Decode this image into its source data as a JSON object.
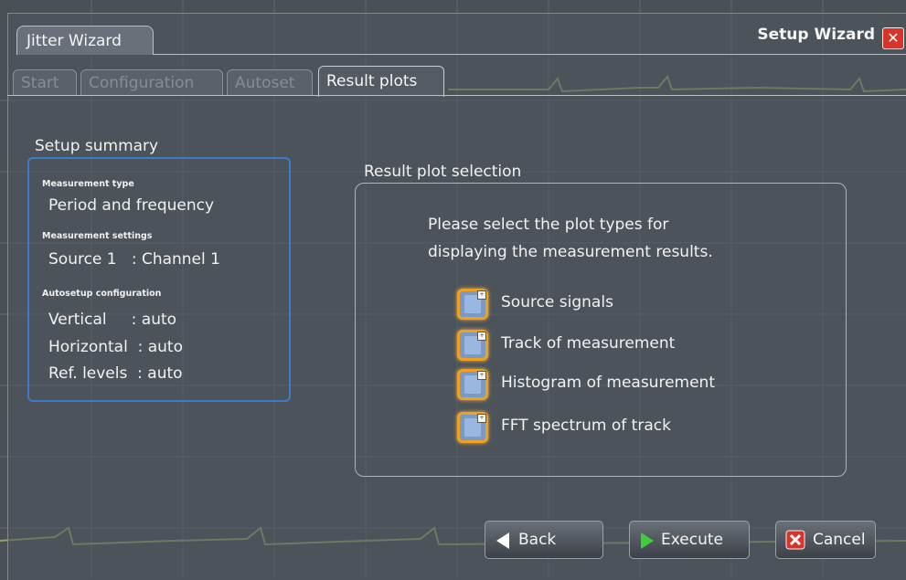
{
  "window": {
    "title_tab": "Jitter Wizard",
    "header_label": "Setup Wizard",
    "close_icon": "close-icon"
  },
  "tabs": [
    {
      "label": "Start",
      "active": false
    },
    {
      "label": "Configuration",
      "active": false
    },
    {
      "label": "Autoset",
      "active": false
    },
    {
      "label": "Result plots",
      "active": true
    }
  ],
  "summary": {
    "title": "Setup summary",
    "measurement_type_label": "Measurement type",
    "measurement_type_value": "Period and frequency",
    "measurement_settings_label": "Measurement settings",
    "source_value": "Source 1   : Channel 1",
    "autosetup_label": "Autosetup configuration",
    "vertical_value": "Vertical     : auto",
    "horizontal_value": "Horizontal  : auto",
    "ref_levels_value": "Ref. levels  : auto"
  },
  "plots": {
    "title": "Result plot selection",
    "instruction_line1": "Please select the plot types for",
    "instruction_line2": "displaying the measurement results.",
    "options": [
      {
        "label": "Source signals",
        "checked": false
      },
      {
        "label": "Track of measurement",
        "checked": false
      },
      {
        "label": "Histogram of measurement",
        "checked": false
      },
      {
        "label": "FFT spectrum of track",
        "checked": false
      }
    ]
  },
  "buttons": {
    "back": "Back",
    "execute": "Execute",
    "cancel": "Cancel"
  },
  "colors": {
    "accent_orange": "#f0a020",
    "summary_border": "#3a7cc9",
    "trace": "#b5c46a",
    "cancel_red": "#d8352a",
    "execute_green": "#3ecf3a"
  }
}
